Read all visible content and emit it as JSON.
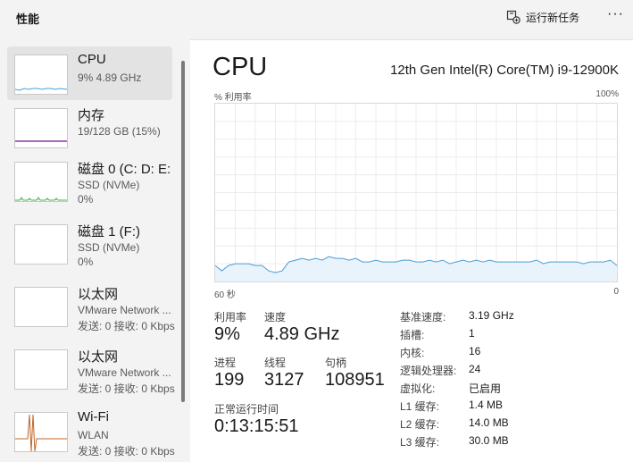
{
  "header": {
    "title": "性能",
    "run_task_label": "运行新任务",
    "more_label": "···"
  },
  "sidebar": {
    "items": [
      {
        "name": "CPU",
        "sub1": "9%  4.89 GHz",
        "sub2": "",
        "selected": true
      },
      {
        "name": "内存",
        "sub1": "19/128 GB (15%)",
        "sub2": ""
      },
      {
        "name": "磁盘 0 (C: D: E:",
        "sub1": "SSD (NVMe)",
        "sub2": "0%"
      },
      {
        "name": "磁盘 1 (F:)",
        "sub1": "SSD (NVMe)",
        "sub2": "0%"
      },
      {
        "name": "以太网",
        "sub1": "VMware Network ...",
        "sub2": "发送: 0 接收: 0 Kbps"
      },
      {
        "name": "以太网",
        "sub1": "VMware Network ...",
        "sub2": "发送: 0 接收: 0 Kbps"
      },
      {
        "name": "Wi-Fi",
        "sub1": "WLAN",
        "sub2": "发送: 0 接收: 0 Kbps"
      }
    ]
  },
  "main": {
    "title": "CPU",
    "model": "12th Gen Intel(R) Core(TM) i9-12900K",
    "graph": {
      "y_label": "% 利用率",
      "y_max_label": "100%",
      "x_left_label": "60 秒",
      "x_right_label": "0"
    },
    "stats": {
      "utilization_label": "利用率",
      "utilization_value": "9%",
      "speed_label": "速度",
      "speed_value": "4.89 GHz",
      "processes_label": "进程",
      "processes_value": "199",
      "threads_label": "线程",
      "threads_value": "3127",
      "handles_label": "句柄",
      "handles_value": "108951",
      "uptime_label": "正常运行时间",
      "uptime_value": "0:13:15:51"
    },
    "specs": [
      {
        "label": "基准速度:",
        "value": "3.19 GHz"
      },
      {
        "label": "插槽:",
        "value": "1"
      },
      {
        "label": "内核:",
        "value": "16"
      },
      {
        "label": "逻辑处理器:",
        "value": "24"
      },
      {
        "label": "虚拟化:",
        "value": "已启用"
      },
      {
        "label": "L1 缓存:",
        "value": "1.4 MB"
      },
      {
        "label": "L2 缓存:",
        "value": "14.0 MB"
      },
      {
        "label": "L3 缓存:",
        "value": "30.0 MB"
      }
    ]
  },
  "colors": {
    "cpu_line": "#4a9fd5",
    "cpu_fill": "#e8f3fb",
    "memory_line": "#8b36a8",
    "disk_line": "#4caf50",
    "wifi_line": "#c1642a",
    "grid": "#ececec"
  },
  "chart_data": {
    "type": "area",
    "x_range": [
      60,
      0
    ],
    "ylim": [
      0,
      100
    ],
    "x": [
      60,
      59,
      58,
      57,
      56,
      55,
      54,
      53,
      52,
      51,
      50,
      49,
      48,
      47,
      46,
      45,
      44,
      43,
      42,
      41,
      40,
      39,
      38,
      37,
      36,
      35,
      34,
      33,
      32,
      31,
      30,
      29,
      28,
      27,
      26,
      25,
      24,
      23,
      22,
      21,
      20,
      19,
      18,
      17,
      16,
      15,
      14,
      13,
      12,
      11,
      10,
      9,
      8,
      7,
      6,
      5,
      4,
      3,
      2,
      1,
      0
    ],
    "values": [
      9,
      6,
      9,
      10,
      10,
      10,
      9,
      9,
      6,
      5,
      6,
      11,
      12,
      13,
      12,
      13,
      12,
      14,
      13,
      13,
      12,
      13,
      11,
      11,
      12,
      11,
      11,
      11,
      12,
      12,
      11,
      11,
      12,
      11,
      12,
      10,
      11,
      12,
      11,
      12,
      11,
      12,
      11,
      11,
      11,
      11,
      11,
      11,
      12,
      10,
      11,
      11,
      11,
      11,
      11,
      10,
      11,
      11,
      11,
      12,
      9
    ],
    "grid": true
  }
}
